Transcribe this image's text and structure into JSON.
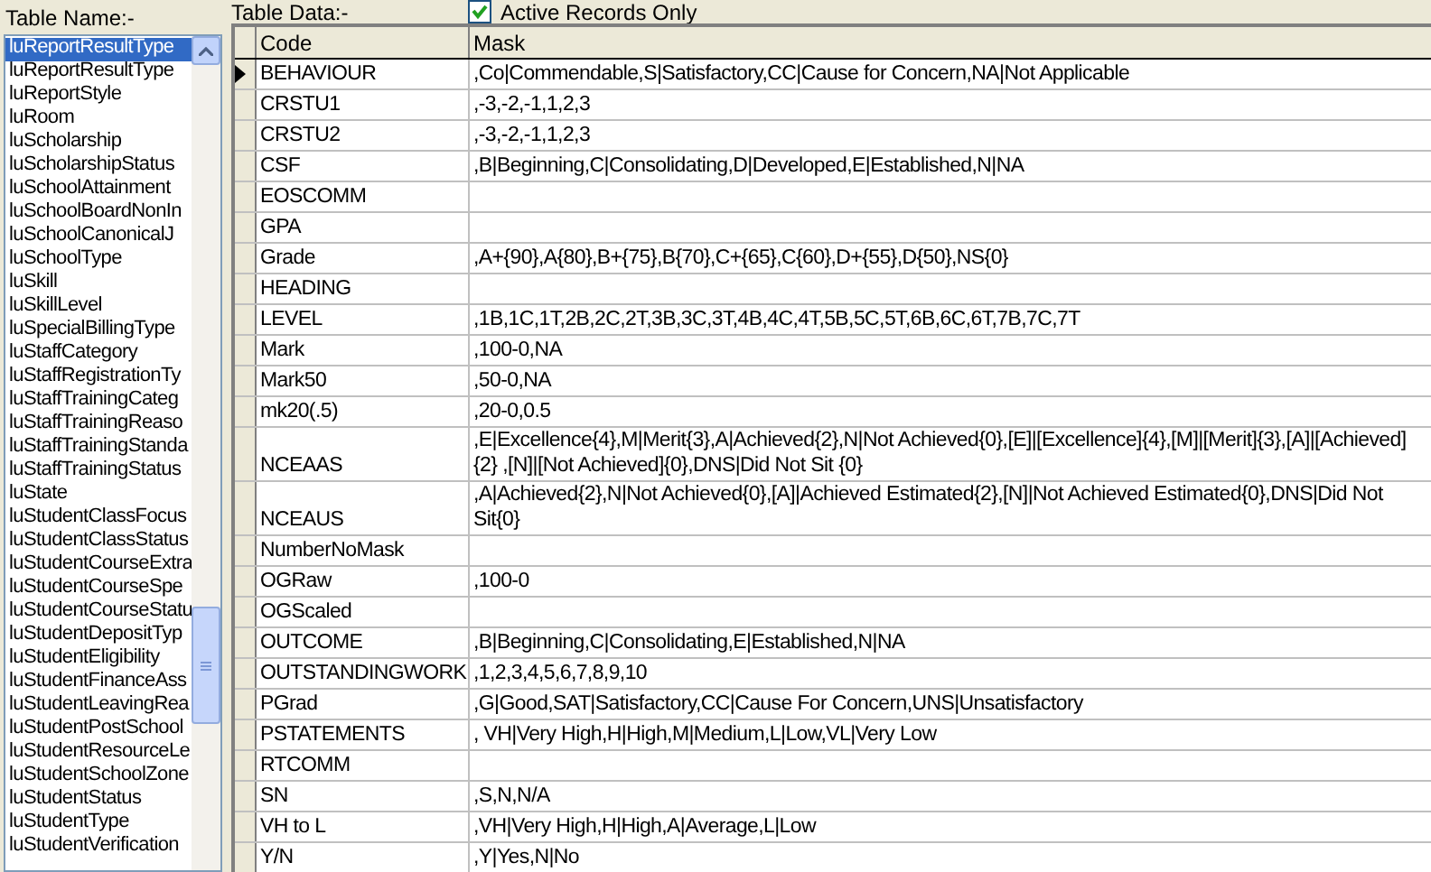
{
  "table_name": {
    "label": "Table Name:-",
    "items": [
      {
        "text": "luReportResultType",
        "selected": true
      },
      {
        "text": "luReportResultType",
        "selected": false
      },
      {
        "text": "luReportStyle",
        "selected": false
      },
      {
        "text": "luRoom",
        "selected": false
      },
      {
        "text": "luScholarship",
        "selected": false
      },
      {
        "text": "luScholarshipStatus",
        "selected": false
      },
      {
        "text": "luSchoolAttainment",
        "selected": false
      },
      {
        "text": "luSchoolBoardNonIn",
        "selected": false
      },
      {
        "text": "luSchoolCanonicalJ",
        "selected": false
      },
      {
        "text": "luSchoolType",
        "selected": false
      },
      {
        "text": "luSkill",
        "selected": false
      },
      {
        "text": "luSkillLevel",
        "selected": false
      },
      {
        "text": "luSpecialBillingType",
        "selected": false
      },
      {
        "text": "luStaffCategory",
        "selected": false
      },
      {
        "text": "luStaffRegistrationTy",
        "selected": false
      },
      {
        "text": "luStaffTrainingCateg",
        "selected": false
      },
      {
        "text": "luStaffTrainingReaso",
        "selected": false
      },
      {
        "text": "luStaffTrainingStanda",
        "selected": false
      },
      {
        "text": "luStaffTrainingStatus",
        "selected": false
      },
      {
        "text": "luState",
        "selected": false
      },
      {
        "text": "luStudentClassFocus",
        "selected": false
      },
      {
        "text": "luStudentClassStatus",
        "selected": false
      },
      {
        "text": "luStudentCourseExtra",
        "selected": false
      },
      {
        "text": "luStudentCourseSpe",
        "selected": false
      },
      {
        "text": "luStudentCourseStatu",
        "selected": false
      },
      {
        "text": "luStudentDepositTyp",
        "selected": false
      },
      {
        "text": "luStudentEligibility",
        "selected": false
      },
      {
        "text": "luStudentFinanceAss",
        "selected": false
      },
      {
        "text": "luStudentLeavingRea",
        "selected": false
      },
      {
        "text": "luStudentPostSchool",
        "selected": false
      },
      {
        "text": "luStudentResourceLe",
        "selected": false
      },
      {
        "text": "luStudentSchoolZone",
        "selected": false
      },
      {
        "text": "luStudentStatus",
        "selected": false
      },
      {
        "text": "luStudentType",
        "selected": false
      },
      {
        "text": "luStudentVerification",
        "selected": false
      }
    ]
  },
  "table_data": {
    "label": "Table Data:-",
    "active_only": {
      "label": "Active Records Only",
      "checked": true
    },
    "columns": [
      "Code",
      "Mask"
    ],
    "rows": [
      {
        "code": "BEHAVIOUR",
        "mask": ",Co|Commendable,S|Satisfactory,CC|Cause for Concern,NA|Not Applicable",
        "current": true
      },
      {
        "code": "CRSTU1",
        "mask": ",-3,-2,-1,1,2,3",
        "current": false
      },
      {
        "code": "CRSTU2",
        "mask": ",-3,-2,-1,1,2,3",
        "current": false
      },
      {
        "code": "CSF",
        "mask": ",B|Beginning,C|Consolidating,D|Developed,E|Established,N|NA",
        "current": false
      },
      {
        "code": "EOSCOMM",
        "current": false
      },
      {
        "code": "GPA",
        "current": false
      },
      {
        "code": "Grade",
        "mask": ",A+{90},A{80},B+{75},B{70},C+{65},C{60},D+{55},D{50},NS{0}",
        "current": false
      },
      {
        "code": "HEADING",
        "current": false
      },
      {
        "code": "LEVEL",
        "mask": ",1B,1C,1T,2B,2C,2T,3B,3C,3T,4B,4C,4T,5B,5C,5T,6B,6C,6T,7B,7C,7T",
        "current": false
      },
      {
        "code": "Mark",
        "mask": ",100-0,NA",
        "current": false
      },
      {
        "code": "Mark50",
        "mask": ",50-0,NA",
        "current": false
      },
      {
        "code": "mk20(.5)",
        "mask": ",20-0,0.5",
        "current": false
      },
      {
        "code": "NCEAAS",
        "mask": ",E|Excellence{4},M|Merit{3},A|Achieved{2},N|Not Achieved{0},[E]|[Excellence]{4},[M]|[Merit]{3},[A]|[Achieved]{2} ,[N]|[Not Achieved]{0},DNS|Did Not Sit {0}",
        "current": false
      },
      {
        "code": "NCEAUS",
        "mask": ",A|Achieved{2},N|Not Achieved{0},[A]|Achieved Estimated{2},[N]|Not Achieved Estimated{0},DNS|Did Not Sit{0}",
        "current": false
      },
      {
        "code": "NumberNoMask",
        "current": false
      },
      {
        "code": "OGRaw",
        "mask": ",100-0",
        "current": false
      },
      {
        "code": "OGScaled",
        "current": false
      },
      {
        "code": "OUTCOME",
        "mask": ",B|Beginning,C|Consolidating,E|Established,N|NA",
        "current": false
      },
      {
        "code": "OUTSTANDINGWORK",
        "mask": ",1,2,3,4,5,6,7,8,9,10",
        "current": false
      },
      {
        "code": "PGrad",
        "mask": ",G|Good,SAT|Satisfactory,CC|Cause For Concern,UNS|Unsatisfactory",
        "current": false
      },
      {
        "code": "PSTATEMENTS",
        "mask": ", VH|Very High,H|High,M|Medium,L|Low,VL|Very Low",
        "current": false
      },
      {
        "code": "RTCOMM",
        "current": false
      },
      {
        "code": "SN",
        "mask": ",S,N,N/A",
        "current": false
      },
      {
        "code": "VH to L",
        "mask": ",VH|Very High,H|High,A|Average,L|Low",
        "current": false
      },
      {
        "code": "Y/N",
        "mask": ",Y|Yes,N|No",
        "current": false
      }
    ]
  }
}
